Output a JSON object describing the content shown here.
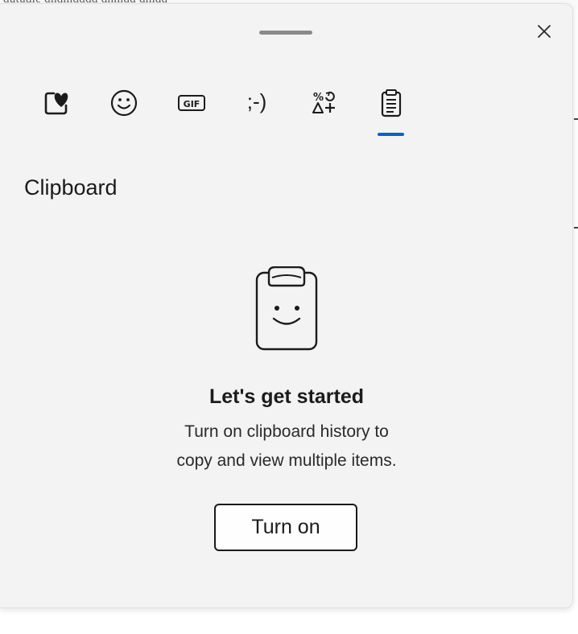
{
  "background": {
    "scrap_text": "dutudie dndmdddd dnmdd dmdd"
  },
  "panel": {
    "tabs": [
      {
        "name": "favorites",
        "icon": "heart-square-icon",
        "label": ""
      },
      {
        "name": "emoji",
        "icon": "smiley-icon",
        "label": ""
      },
      {
        "name": "gif",
        "icon": "gif-icon",
        "label": "GIF"
      },
      {
        "name": "kaomoji",
        "icon": "kaomoji-icon",
        "label": ";-)"
      },
      {
        "name": "symbols",
        "icon": "symbols-icon",
        "label": ""
      },
      {
        "name": "clipboard",
        "icon": "clipboard-icon",
        "label": "",
        "selected": true
      }
    ],
    "section_title": "Clipboard",
    "empty_state": {
      "heading": "Let's get started",
      "line1": "Turn on clipboard history to",
      "line2": "copy and view multiple items.",
      "button_label": "Turn on"
    },
    "colors": {
      "accent": "#0f5fc4",
      "panel_bg": "#f3f3f3"
    }
  }
}
